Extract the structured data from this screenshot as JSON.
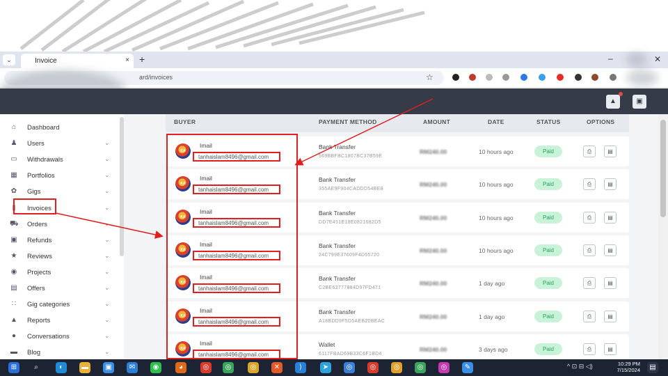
{
  "browser": {
    "tab_title": "Invoice",
    "tab_close": "×",
    "new_tab": "+",
    "minimize": "–",
    "close": "✕",
    "url": "ard/invoices",
    "menu_glyph": "⌄"
  },
  "sidebar": {
    "items": [
      {
        "label": "Dashboard",
        "icon": "home-icon",
        "glyph": "⌂",
        "chevron": false
      },
      {
        "label": "Users",
        "icon": "users-icon",
        "glyph": "♟",
        "chevron": true
      },
      {
        "label": "Withdrawals",
        "icon": "card-icon",
        "glyph": "▭",
        "chevron": true
      },
      {
        "label": "Portfolios",
        "icon": "portfolio-icon",
        "glyph": "▦",
        "chevron": true
      },
      {
        "label": "Gigs",
        "icon": "gigs-icon",
        "glyph": "✿",
        "chevron": true
      },
      {
        "label": "Invoices",
        "icon": "invoice-icon",
        "glyph": "▯",
        "chevron": true
      },
      {
        "label": "Orders",
        "icon": "cart-icon",
        "glyph": "⛟",
        "chevron": true
      },
      {
        "label": "Refunds",
        "icon": "refund-icon",
        "glyph": "▣",
        "chevron": true
      },
      {
        "label": "Reviews",
        "icon": "star-icon",
        "glyph": "★",
        "chevron": true
      },
      {
        "label": "Projects",
        "icon": "projects-icon",
        "glyph": "◉",
        "chevron": true
      },
      {
        "label": "Offers",
        "icon": "offers-icon",
        "glyph": "▤",
        "chevron": true
      },
      {
        "label": "Gig categories",
        "icon": "categories-icon",
        "glyph": "∷",
        "chevron": true
      },
      {
        "label": "Reports",
        "icon": "reports-icon",
        "glyph": "▲",
        "chevron": true
      },
      {
        "label": "Conversations",
        "icon": "chat-icon",
        "glyph": "●",
        "chevron": true
      },
      {
        "label": "Blog",
        "icon": "blog-icon",
        "glyph": "▬",
        "chevron": true
      }
    ],
    "chevron_glyph": "⌄"
  },
  "table": {
    "headers": {
      "buyer": "BUYER",
      "payment_method": "PAYMENT METHOD",
      "amount": "AMOUNT",
      "date": "DATE",
      "status": "STATUS",
      "options": "OPTIONS"
    },
    "rows": [
      {
        "avatar_text": "KA",
        "name": "Imail",
        "email": "tanhaislam8496@gmail.com",
        "method": "Bank Transfer",
        "ref": "569BBFBC1807BC37B59E",
        "amount": "RM240.00",
        "date": "10 hours ago",
        "status": "Paid"
      },
      {
        "avatar_text": "KA",
        "name": "Imail",
        "email": "tanhaislam8496@gmail.com",
        "method": "Bank Transfer",
        "ref": "355AE9F904CADDD54BE8",
        "amount": "RM240.00",
        "date": "10 hours ago",
        "status": "Paid"
      },
      {
        "avatar_text": "KA",
        "name": "Imail",
        "email": "tanhaislam8496@gmail.com",
        "method": "Bank Transfer",
        "ref": "DD7E451E18E0821682D5",
        "amount": "RM240.00",
        "date": "10 hours ago",
        "status": "Paid"
      },
      {
        "avatar_text": "KA",
        "name": "Imail",
        "email": "tanhaislam8496@gmail.com",
        "method": "Bank Transfer",
        "ref": "24C799E37609F4D55720",
        "amount": "RM240.00",
        "date": "10 hours ago",
        "status": "Paid"
      },
      {
        "avatar_text": "KA",
        "name": "Imail",
        "email": "tanhaislam8496@gmail.com",
        "method": "Bank Transfer",
        "ref": "C2BE63777884D97FD471",
        "amount": "RM240.00",
        "date": "1 day ago",
        "status": "Paid"
      },
      {
        "avatar_text": "KA",
        "name": "Imail",
        "email": "tanhaislam8496@gmail.com",
        "method": "Bank Transfer",
        "ref": "A18BDD9F5D5AEB20BEAC",
        "amount": "RM240.00",
        "date": "1 day ago",
        "status": "Paid"
      },
      {
        "avatar_text": "KA",
        "name": "Imail",
        "email": "tanhaislam8496@gmail.com",
        "method": "Wallet",
        "ref": "6117FBAD69B33C6F1BD4",
        "amount": "RM240.00",
        "date": "3 days ago",
        "status": "Paid"
      }
    ],
    "option_view_glyph": "⎙",
    "option_edit_glyph": "▤"
  },
  "taskbar": {
    "time": "10:29 PM",
    "date": "7/15/2024",
    "tray": "^ ⊡ ⊟ ◁)"
  },
  "colors": {
    "header": "#353c47",
    "accent_red": "#e02020",
    "paid_bg": "#c8f3d8",
    "paid_text": "#27a35a",
    "taskbar": "#1c2333"
  }
}
